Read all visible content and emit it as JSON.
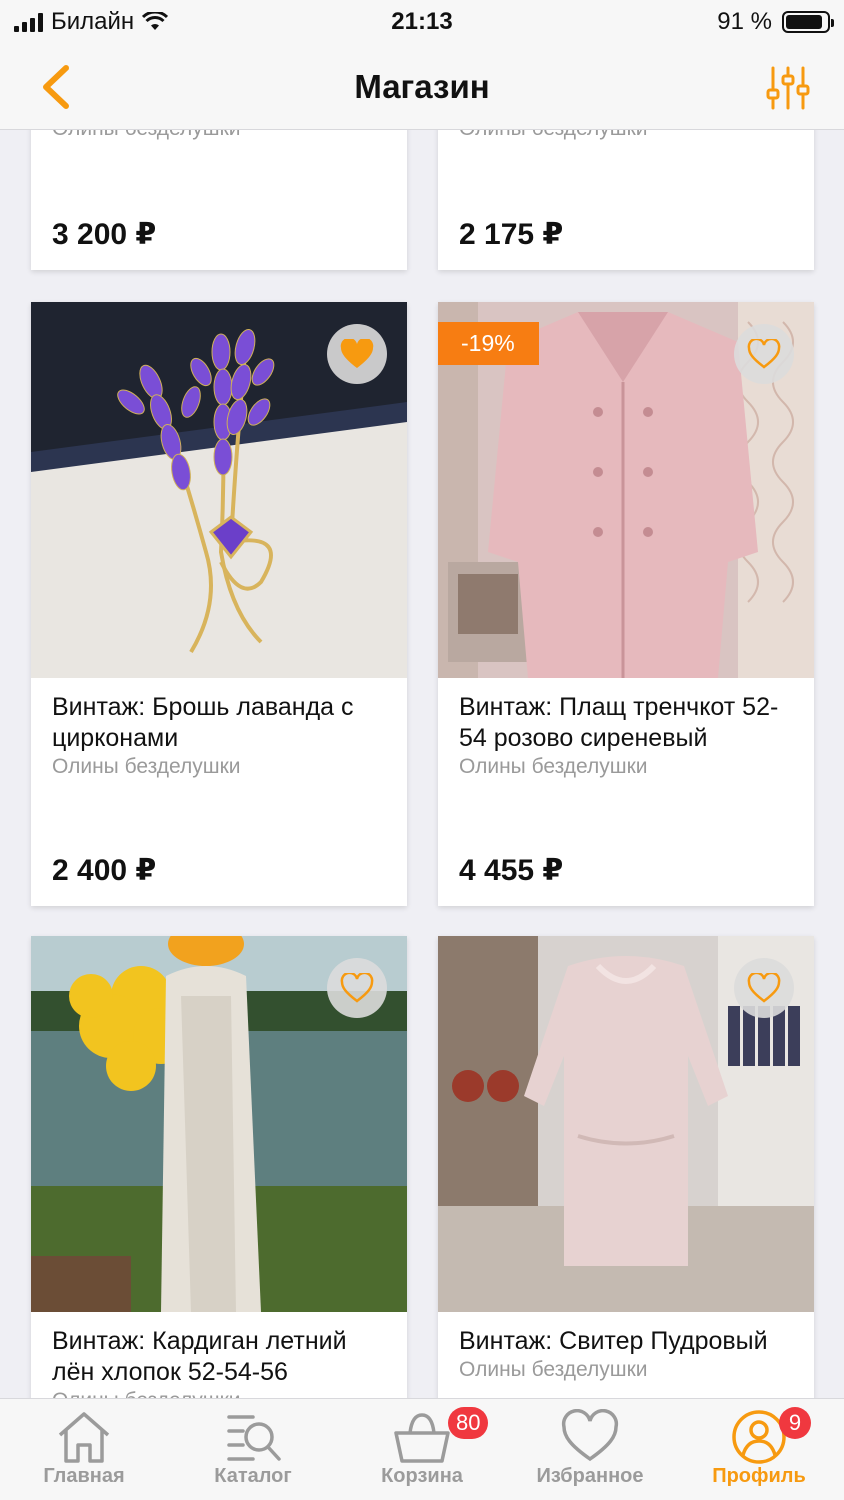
{
  "status": {
    "carrier": "Билайн",
    "time": "21:13",
    "battery": "91 %",
    "battery_level": 0.91
  },
  "nav": {
    "title": "Магазин"
  },
  "colors": {
    "accent": "#f79a10",
    "badge": "#f0383f",
    "discount": "#f77d12"
  },
  "products": [
    {
      "title": "",
      "shop": "Олины безделушки",
      "price": "3 200 ₽"
    },
    {
      "title": "",
      "shop": "Олины безделушки",
      "price": "2 175 ₽"
    },
    {
      "title": "Винтаж: Брошь лаванда с цирконами",
      "shop": "Олины безделушки",
      "price": "2 400 ₽",
      "favorited": true,
      "image": "brooch-photo"
    },
    {
      "title": "Винтаж: Плащ тренчкот 52-54 розово сиреневый",
      "shop": "Олины безделушки",
      "price": "4 455 ₽",
      "discount": "-19%",
      "favorited": false,
      "image": "trench-coat-photo"
    },
    {
      "title": "Винтаж: Кардиган летний лён хлопок 52-54-56",
      "shop": "Олины безделушки",
      "favorited": false,
      "image": "cardigan-photo"
    },
    {
      "title": "Винтаж: Свитер Пудровый",
      "shop": "Олины безделушки",
      "favorited": false,
      "image": "sweater-photo"
    }
  ],
  "tabs": [
    {
      "label": "Главная",
      "icon": "home-icon"
    },
    {
      "label": "Каталог",
      "icon": "catalog-search-icon"
    },
    {
      "label": "Корзина",
      "icon": "basket-icon",
      "badge": "80"
    },
    {
      "label": "Избранное",
      "icon": "heart-icon"
    },
    {
      "label": "Профиль",
      "icon": "profile-icon",
      "badge": "9",
      "active": true
    }
  ]
}
